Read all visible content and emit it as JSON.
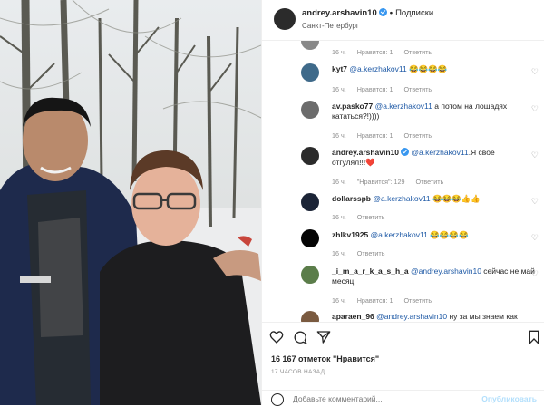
{
  "post": {
    "author": "andrey.arshavin10",
    "follow_label": "Подписки",
    "location": "Санкт-Петербург"
  },
  "comments": [
    {
      "user": "",
      "text": "",
      "time": "16 ч.",
      "like_label": "Нравится: 1",
      "reply_label": "Ответить"
    },
    {
      "user": "kyt7",
      "mention": "@a.kerzhakov11",
      "text": "😂😂😂😂",
      "time": "16 ч.",
      "like_label": "Нравится: 1",
      "reply_label": "Ответить"
    },
    {
      "user": "av.pasko77",
      "mention": "@a.kerzhakov11",
      "text": "а потом на лошадях",
      "text2": "кататься?!))))",
      "time": "16 ч.",
      "like_label": "Нравится: 1",
      "reply_label": "Ответить"
    },
    {
      "user": "andrey.arshavin10",
      "mention": "@a.kerzhakov11",
      "text": ".Я своё",
      "text2": "отгулял!!!❤️",
      "time": "16 ч.",
      "like_label": "\"Нравится\": 129",
      "reply_label": "Ответить"
    },
    {
      "user": "dollarsspb",
      "mention": "@a.kerzhakov11",
      "text": "😂😂😂👍👍",
      "time": "16 ч.",
      "reply_label": "Ответить"
    },
    {
      "user": "zhlkv1925",
      "mention": "@a.kerzhakov11",
      "text": "😂😂😂😂",
      "time": "16 ч.",
      "reply_label": "Ответить"
    },
    {
      "user": "_i_m_a_r_k_a_s_h_a",
      "mention": "@andrey.arshavin10",
      "text": "сейчас не май",
      "text2": "месяц",
      "time": "16 ч.",
      "like_label": "Нравится: 1",
      "reply_label": "Ответить"
    },
    {
      "user": "aparaen_96",
      "mention": "@andrey.arshavin10",
      "text": "ну за мы знаем как"
    }
  ],
  "actions": {
    "like_icon": "heart-outline-icon",
    "comment_icon": "comment-icon",
    "share_icon": "paper-plane-icon",
    "save_icon": "bookmark-icon"
  },
  "likes_text": "16 167 отметок \"Нравится\"",
  "posted_ago": "17 ЧАСОВ НАЗАД",
  "comment_input": {
    "placeholder": "Добавьте комментарий...",
    "publish_label": "Опубликовать"
  },
  "colors": {
    "mention": "#1f5aa6",
    "verified": "#3897f0",
    "secondary_text": "#8e8e8e",
    "heart_emoji": "#e0245e"
  }
}
